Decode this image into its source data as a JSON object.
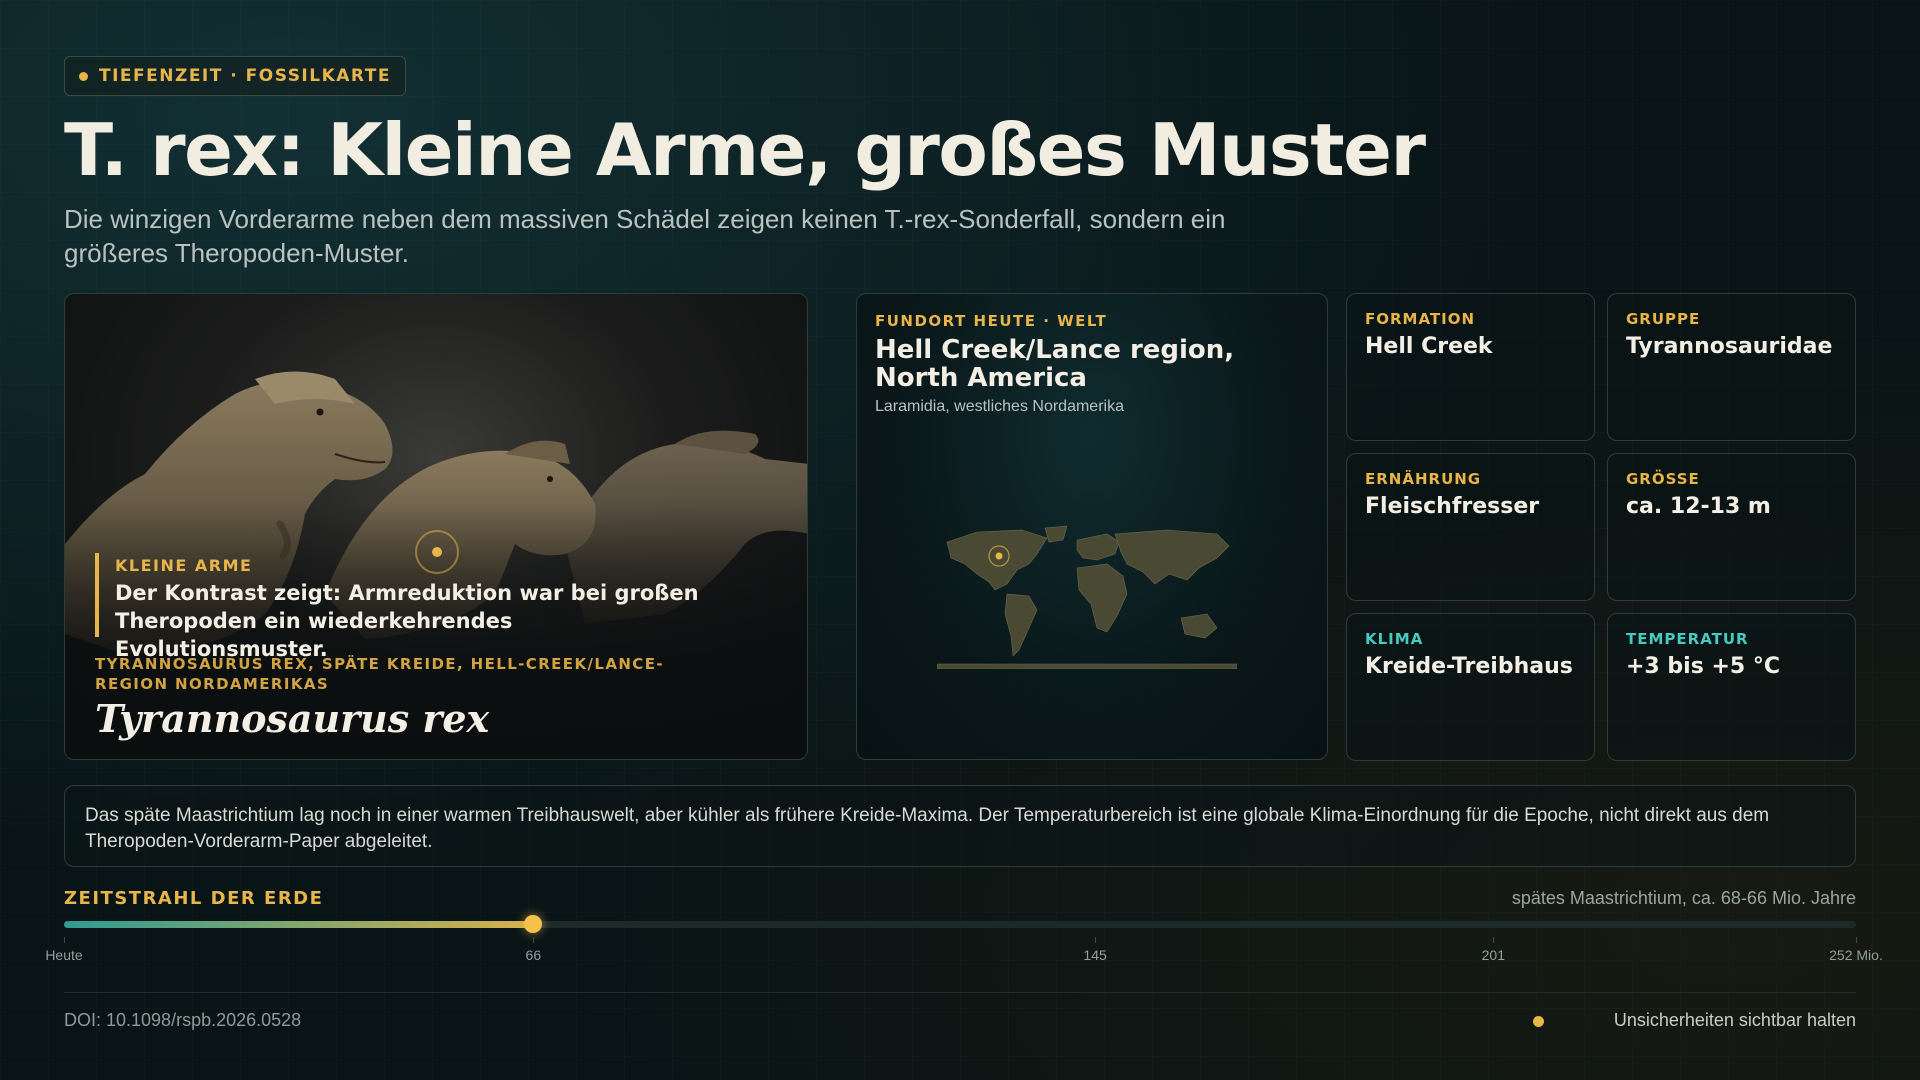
{
  "badge": {
    "label": "TIEFENZEIT · FOSSILKARTE"
  },
  "title": "T. rex: Kleine Arme, großes Muster",
  "subtitle": "Die winzigen Vorderarme neben dem massiven Schädel zeigen keinen T.-rex-Sonderfall, sondern ein größeres Theropoden-Muster.",
  "hero": {
    "kicker": "KLEINE ARME",
    "quote": "Der Kontrast zeigt: Armreduktion war bei großen Theropoden ein wiederkehrendes Evolutionsmuster.",
    "caption": "TYRANNOSAURUS REX, SPÄTE KREIDE, HELL-CREEK/LANCE-REGION NORDAMERIKAS",
    "species": "Tyrannosaurus rex"
  },
  "location": {
    "label": "FUNDORT HEUTE · WELT",
    "title": "Hell Creek/Lance region, North America",
    "subtitle": "Laramidia, westliches Nordamerika"
  },
  "facts": [
    {
      "label": "FORMATION",
      "value": "Hell Creek",
      "accent": "#e8b54a"
    },
    {
      "label": "GRUPPE",
      "value": "Tyrannosauridae",
      "accent": "#e8b54a"
    },
    {
      "label": "ERNÄHRUNG",
      "value": "Fleischfresser",
      "accent": "#e8b54a"
    },
    {
      "label": "GRÖSSE",
      "value": "ca. 12-13 m",
      "accent": "#e8b54a"
    },
    {
      "label": "KLIMA",
      "value": "Kreide-Treibhaus",
      "accent": "#48c9c2"
    },
    {
      "label": "TEMPERATUR",
      "value": "+3 bis +5 °C",
      "accent": "#48c9c2"
    }
  ],
  "note": "Das späte Maastrichtium lag noch in einer warmen Treibhauswelt, aber kühler als frühere Kreide-Maxima. Der Temperaturbereich ist eine globale Klima-Einordnung für die Epoche, nicht direkt aus dem Theropoden-Vorderarm-Paper abgeleitet.",
  "timeline": {
    "title": "ZEITSTRAHL DER ERDE",
    "era": "spätes Maastrichtium, ca. 68-66 Mio. Jahre",
    "max_mya": 252,
    "current_mya": 66,
    "ticks": [
      {
        "value": 0,
        "label": "Heute"
      },
      {
        "value": 66,
        "label": "66"
      },
      {
        "value": 145,
        "label": "145"
      },
      {
        "value": 201,
        "label": "201"
      },
      {
        "value": 252,
        "label": "252 Mio."
      }
    ]
  },
  "footer": {
    "doi": "DOI: 10.1098/rspb.2026.0528",
    "right": "Unsicherheiten sichtbar halten"
  }
}
